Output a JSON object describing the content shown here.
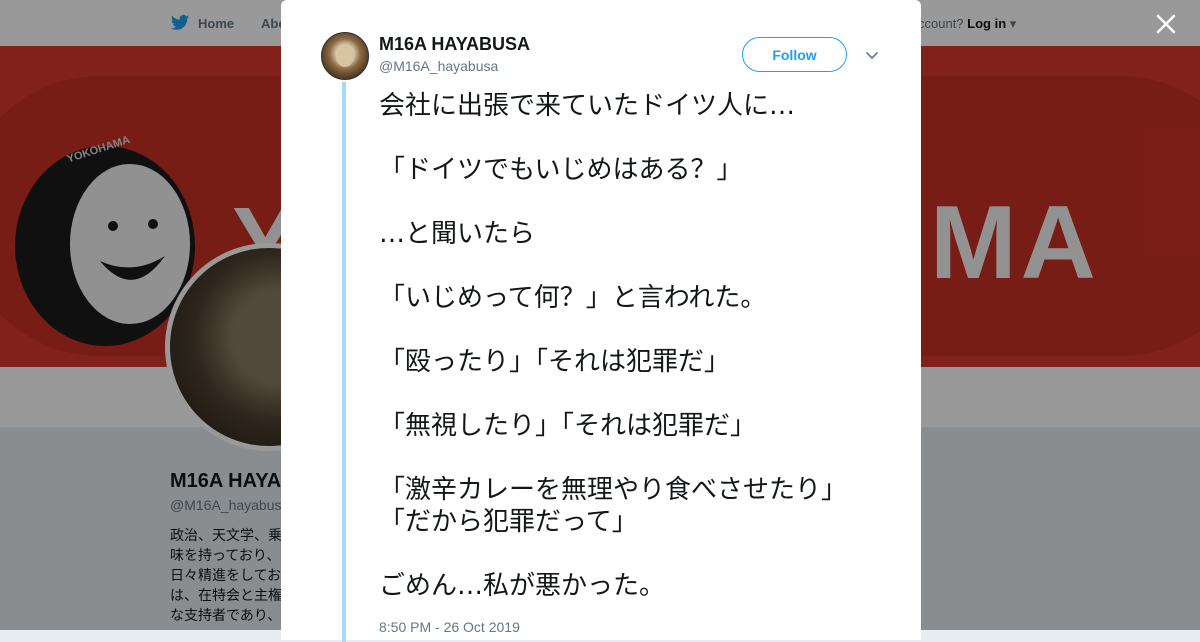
{
  "nav": {
    "home_label": "Home",
    "about_label": "Abo",
    "account_prompt": "ccount?",
    "login_label": "Log in"
  },
  "banner": {
    "text": "MA",
    "tire_text": "YOKOHAMA",
    "letter_left": "Y"
  },
  "profile": {
    "name": "M16A HAYA",
    "handle": "@M16A_hayabusa",
    "bio": [
      "政治、天文学、乗",
      "味を持っており、",
      "日々精進をしてお",
      "は、在特会と主権",
      "な支持者であり、"
    ]
  },
  "tweet": {
    "author_name": "M16A HAYABUSA",
    "author_handle": "@M16A_hayabusa",
    "follow_label": "Follow",
    "lines": [
      "会社に出張で来ていたドイツ人に…",
      "",
      "「ドイツでもいじめはある？」",
      "",
      "…と聞いたら",
      "",
      "「いじめって何？」と言われた。",
      "",
      "「殴ったり」「それは犯罪だ」",
      "",
      "「無視したり」「それは犯罪だ」",
      "",
      "「激辛カレーを無理やり食べさせたり」",
      "「だから犯罪だって」",
      "",
      "ごめん…私が悪かった。"
    ],
    "timestamp": "8:50 PM - 26 Oct 2019"
  },
  "colors": {
    "brand_blue": "#1da1f2",
    "thread_line": "#a9daf5",
    "banner_red": "#d8372c"
  },
  "icons": [
    "twitter-bird-icon",
    "close-icon",
    "chevron-down-icon",
    "caret-down-icon"
  ]
}
